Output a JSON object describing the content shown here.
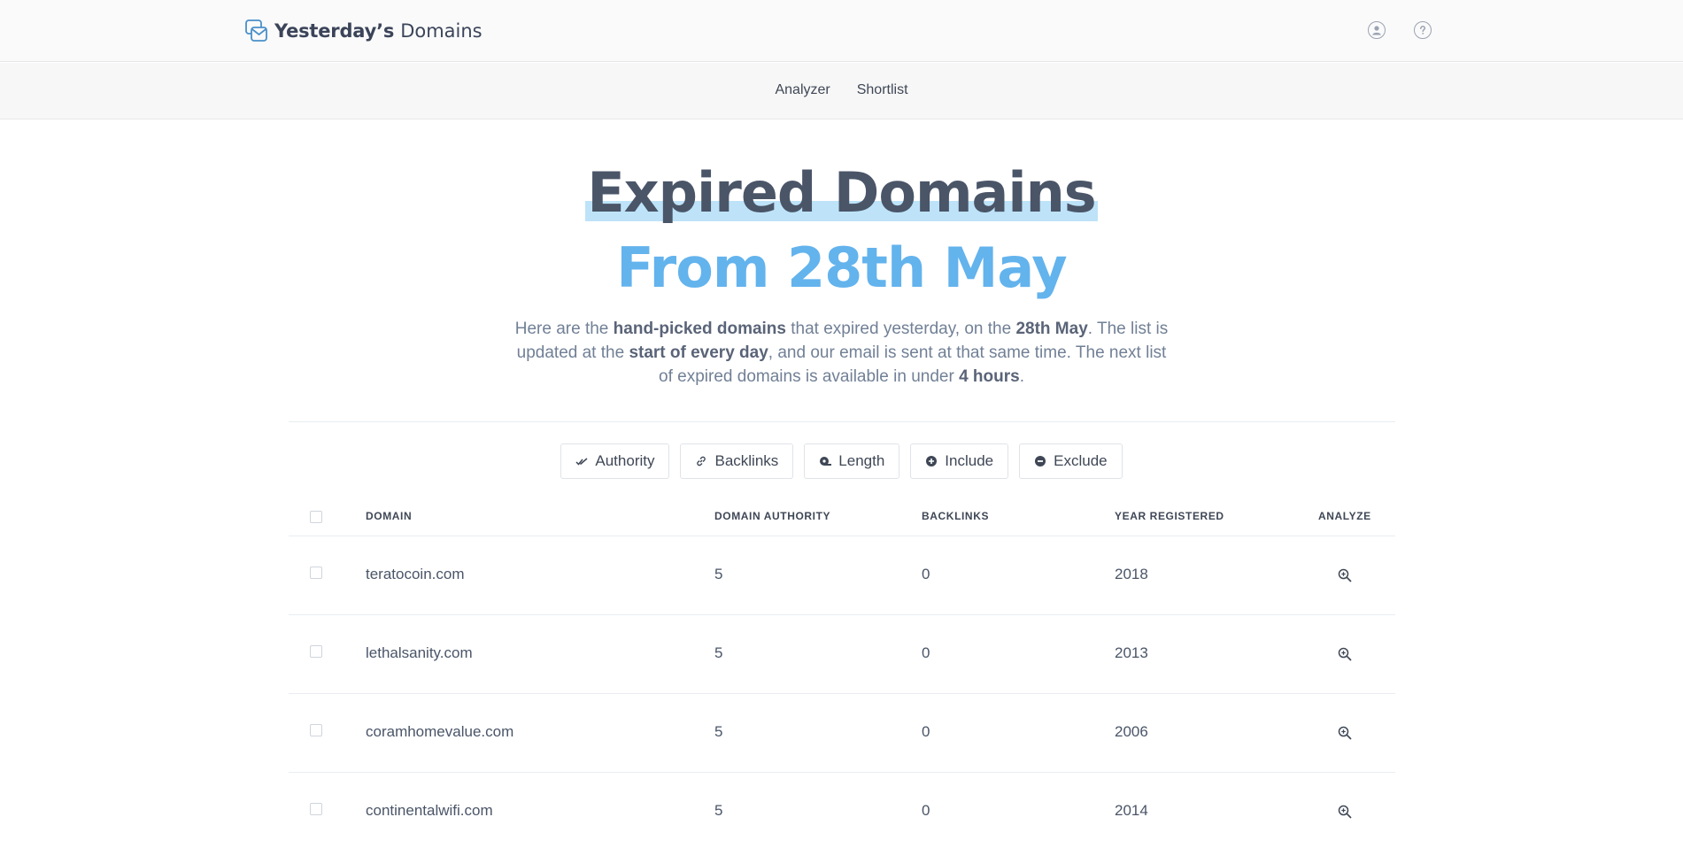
{
  "header": {
    "brand_strong": "Yesterday’s",
    "brand_light": "Domains",
    "account_icon": "user-circle-icon",
    "help_icon": "question-circle-icon"
  },
  "nav": {
    "items": [
      {
        "label": "Analyzer"
      },
      {
        "label": "Shortlist"
      }
    ]
  },
  "hero": {
    "title": "Expired Domains",
    "subtitle": "From 28th May",
    "text_1": "Here are the ",
    "text_2": "hand-picked domains",
    "text_3": " that expired yesterday, on the ",
    "text_4": "28th May",
    "text_5": ". The list is updated at the ",
    "text_6": "start of every day",
    "text_7": ", and our email is sent at that same time. The next list of expired domains is available in under ",
    "text_8": "4 hours",
    "text_9": "."
  },
  "filters": [
    {
      "label": "Authority",
      "icon": "double-check-icon"
    },
    {
      "label": "Backlinks",
      "icon": "link-icon"
    },
    {
      "label": "Length",
      "icon": "ruler-tape-icon"
    },
    {
      "label": "Include",
      "icon": "plus-circle-icon"
    },
    {
      "label": "Exclude",
      "icon": "minus-circle-icon"
    }
  ],
  "table": {
    "columns": {
      "domain": "DOMAIN",
      "authority": "DOMAIN AUTHORITY",
      "backlinks": "BACKLINKS",
      "year": "YEAR REGISTERED",
      "analyze": "ANALYZE"
    },
    "rows": [
      {
        "domain": "teratocoin.com",
        "authority": "5",
        "backlinks": "0",
        "year": "2018"
      },
      {
        "domain": "lethalsanity.com",
        "authority": "5",
        "backlinks": "0",
        "year": "2013"
      },
      {
        "domain": "coramhomevalue.com",
        "authority": "5",
        "backlinks": "0",
        "year": "2006"
      },
      {
        "domain": "continentalwifi.com",
        "authority": "5",
        "backlinks": "0",
        "year": "2014"
      }
    ]
  },
  "colors": {
    "accent": "#63b3ed",
    "highlight": "#bee3f8",
    "text_dark": "#4a5568"
  }
}
